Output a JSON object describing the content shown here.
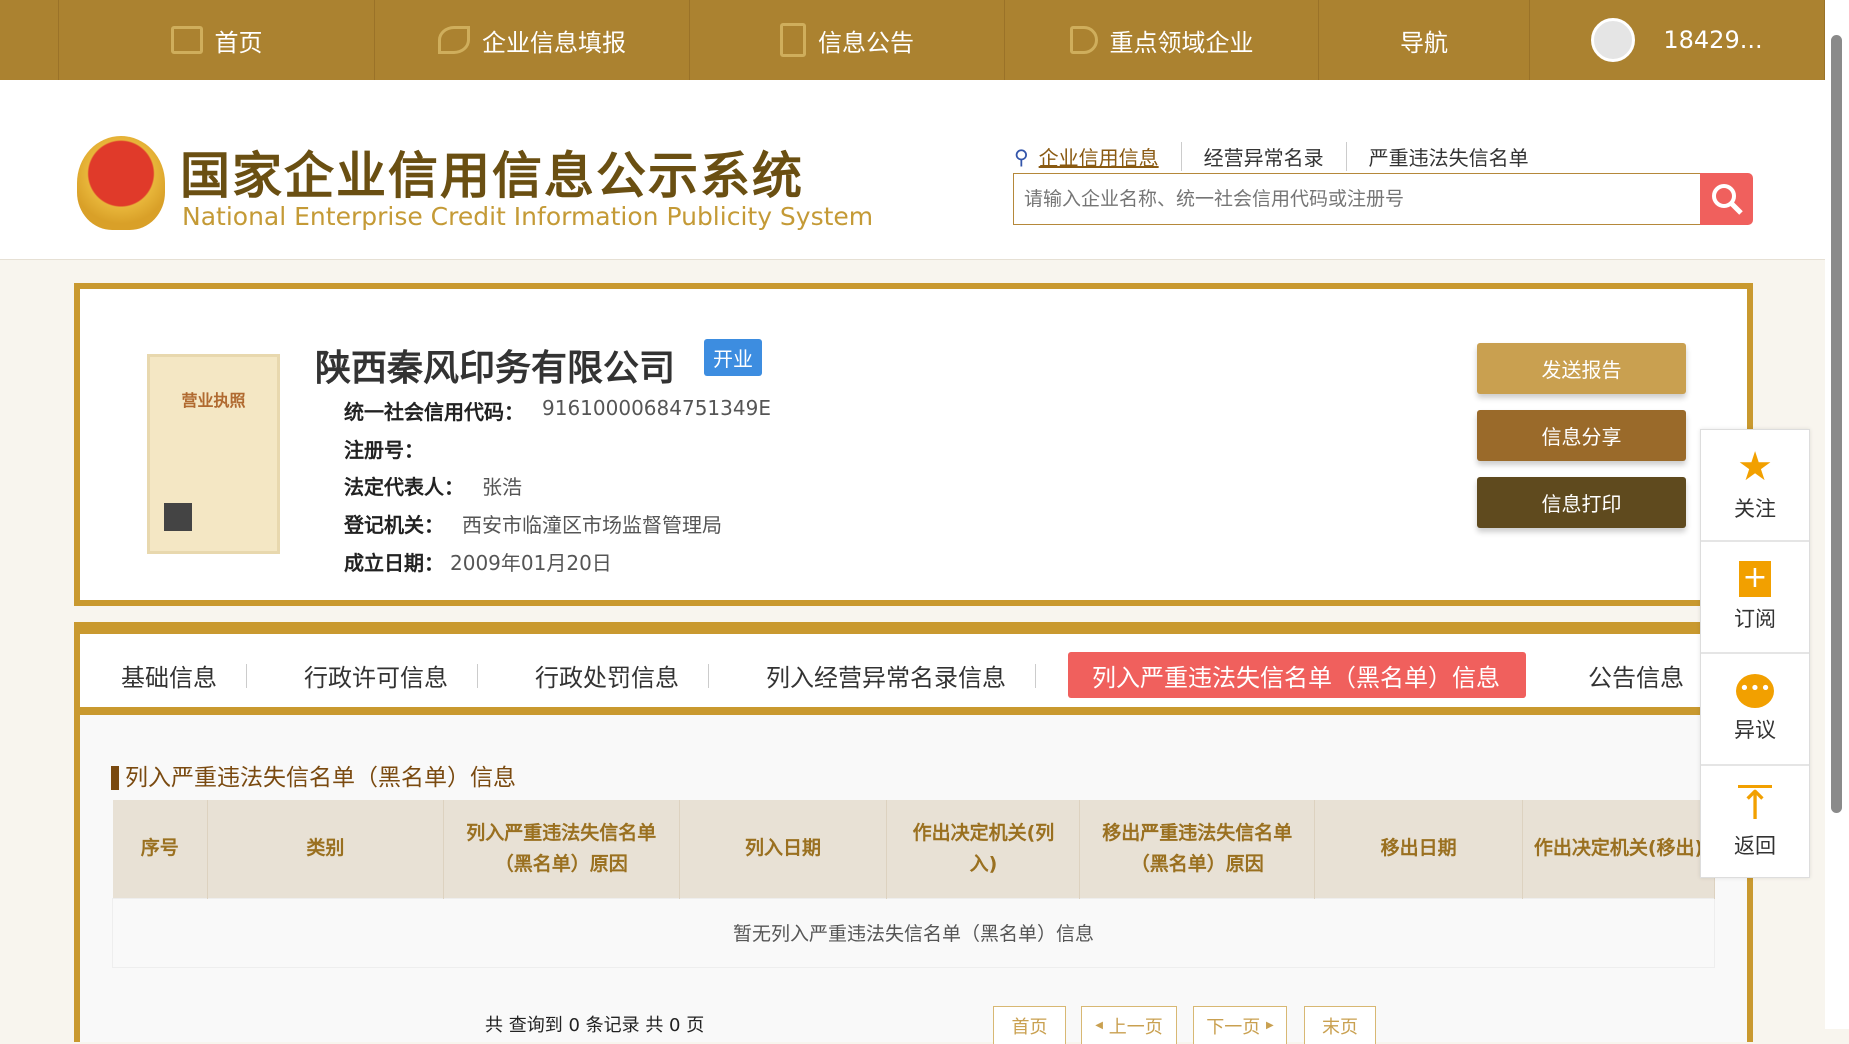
{
  "nav": {
    "items": [
      {
        "label": "首页",
        "icon": "monitor-icon"
      },
      {
        "label": "企业信息填报",
        "icon": "pen-icon"
      },
      {
        "label": "信息公告",
        "icon": "document-icon"
      },
      {
        "label": "重点领域企业",
        "icon": "speaker-icon"
      },
      {
        "label": "导航"
      }
    ],
    "user": "18429..."
  },
  "header": {
    "title": "国家企业信用信息公示系统",
    "subtitle": "National Enterprise Credit Information Publicity System",
    "search_tabs": [
      "企业信用信息",
      "经营异常名录",
      "严重违法失信名单"
    ],
    "search_placeholder": "请输入企业名称、统一社会信用代码或注册号"
  },
  "company": {
    "name": "陕西秦风印务有限公司",
    "status": "开业",
    "license_label": "营业执照",
    "fields": [
      {
        "label": "统一社会信用代码：",
        "value": "91610000684751349E"
      },
      {
        "label": "注册号：",
        "value": ""
      },
      {
        "label": "法定代表人：",
        "value": "张浩"
      },
      {
        "label": "登记机关：",
        "value": "西安市临潼区市场监督管理局"
      },
      {
        "label": "成立日期：",
        "value": "2009年01月20日"
      }
    ]
  },
  "actions": {
    "send": "发送报告",
    "share": "信息分享",
    "print": "信息打印"
  },
  "tabs": [
    "基础信息",
    "行政许可信息",
    "行政处罚信息",
    "列入经营异常名录信息",
    "列入严重违法失信名单（黑名单）信息",
    "公告信息"
  ],
  "section": {
    "title": "列入严重违法失信名单（黑名单）信息",
    "columns": [
      "序号",
      "类别",
      "列入严重违法失信名单（黑名单）原因",
      "列入日期",
      "作出决定机关(列入)",
      "移出严重违法失信名单（黑名单）原因",
      "移出日期",
      "作出决定机关(移出)"
    ],
    "empty": "暂无列入严重违法失信名单（黑名单）信息"
  },
  "pagination": {
    "summary": "共 查询到 0 条记录 共 0 页",
    "first": "首页",
    "prev": "上一页",
    "next": "下一页",
    "last": "末页"
  },
  "side": [
    {
      "label": "关注",
      "icon": "star-icon"
    },
    {
      "label": "订阅",
      "icon": "subscribe-plus-icon"
    },
    {
      "label": "异议",
      "icon": "chat-bubble-icon"
    },
    {
      "label": "返回",
      "icon": "back-to-top-icon"
    }
  ]
}
